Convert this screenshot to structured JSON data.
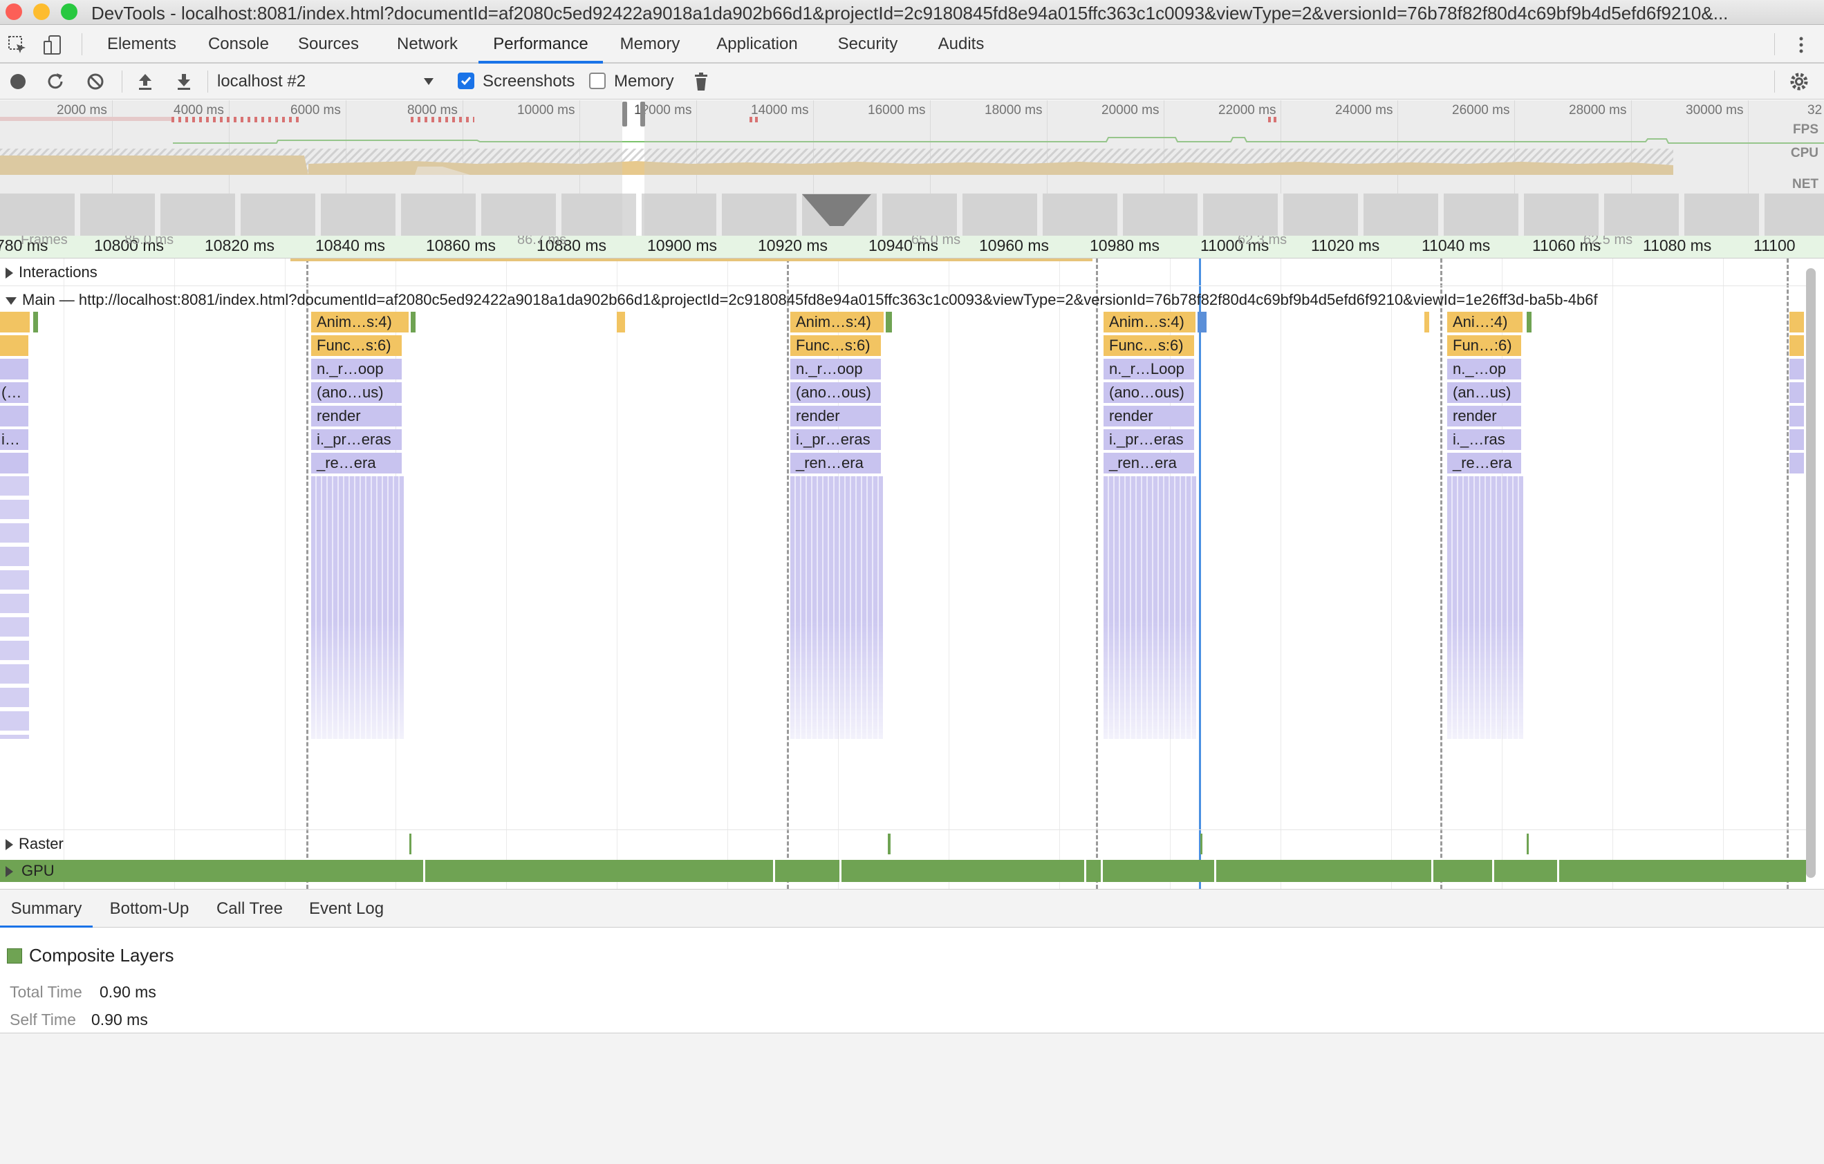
{
  "window": {
    "title": "DevTools - localhost:8081/index.html?documentId=af2080c5ed92422a9018a1da902b66d1&projectId=2c9180845fd8e94a015ffc363c1c0093&viewType=2&versionId=76b78f82f80d4c69bf9b4d5efd6f9210&..."
  },
  "tabs": [
    "Elements",
    "Console",
    "Sources",
    "Network",
    "Performance",
    "Memory",
    "Application",
    "Security",
    "Audits"
  ],
  "active_tab": "Performance",
  "toolbar": {
    "target": "localhost #2",
    "screenshots_label": "Screenshots",
    "screenshots_checked": true,
    "memory_label": "Memory",
    "memory_checked": false
  },
  "overview": {
    "ticks": [
      "2000 ms",
      "4000 ms",
      "6000 ms",
      "8000 ms",
      "10000 ms",
      "1?000 ms",
      "14000 ms",
      "16000 ms",
      "18000 ms",
      "20000 ms",
      "22000 ms",
      "24000 ms",
      "26000 ms",
      "28000 ms",
      "30000 ms",
      "32"
    ],
    "track_labels": {
      "fps": "FPS",
      "cpu": "CPU",
      "net": "NET"
    }
  },
  "timeline": {
    "ticks": [
      "780 ms",
      "10800 ms",
      "10820 ms",
      "10840 ms",
      "10860 ms",
      "10880 ms",
      "10900 ms",
      "10920 ms",
      "10940 ms",
      "10960 ms",
      "10980 ms",
      "11000 ms",
      "11020 ms",
      "11040 ms",
      "11060 ms",
      "11080 ms",
      "11100"
    ],
    "frame_labels": [
      "Frames",
      "85.0 ms",
      "86.7 ms",
      "65.0 ms",
      "62.3 ms",
      "62.5 ms"
    ]
  },
  "tracks": {
    "interactions": "Interactions",
    "main": "Main — http://localhost:8081/index.html?documentId=af2080c5ed92422a9018a1da902b66d1&projectId=2c9180845fd8e94a015ffc363c1c0093&viewType=2&versionId=76b78f82f80d4c69bf9b4d5efd6f9210&viewId=1e26ff3d-ba5b-4b6f",
    "raster": "Raster",
    "gpu": "GPU"
  },
  "flame_columns": [
    {
      "labels": [
        "",
        "",
        "",
        "(…",
        "",
        "i…",
        ""
      ]
    },
    {
      "labels": [
        "Anim…s:4)",
        "Func…s:6)",
        "n._r…oop",
        "(ano…us)",
        "render",
        "i._pr…eras",
        "_re…era"
      ]
    },
    {
      "labels": [
        "Anim…s:4)",
        "Func…s:6)",
        "n._r…oop",
        "(ano…ous)",
        "render",
        "i._pr…eras",
        "_ren…era"
      ]
    },
    {
      "labels": [
        "Anim…s:4)",
        "Func…s:6)",
        "n._r…Loop",
        "(ano…ous)",
        "render",
        "i._pr…eras",
        "_ren…era"
      ]
    },
    {
      "labels": [
        "Ani…:4)",
        "Fun…:6)",
        "n._…op",
        "(an…us)",
        "render",
        "i._…ras",
        "_re…era"
      ]
    }
  ],
  "bottom_tabs": [
    "Summary",
    "Bottom-Up",
    "Call Tree",
    "Event Log"
  ],
  "active_bottom_tab": "Summary",
  "summary": {
    "title": "Composite Layers",
    "swatch_color": "#6fa353",
    "total_time_label": "Total Time",
    "total_time": "0.90 ms",
    "self_time_label": "Self Time",
    "self_time": "0.90 ms"
  },
  "colors": {
    "scripting": "#f2c462",
    "rendering": "#c8c3ef",
    "gpu": "#6fa353",
    "accent": "#1a73e8"
  }
}
